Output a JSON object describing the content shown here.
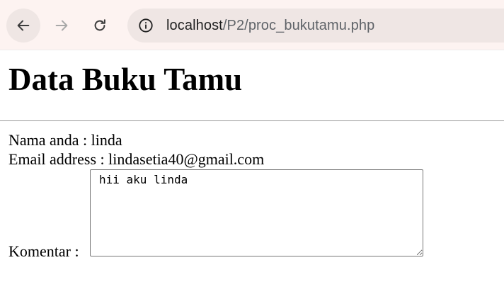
{
  "browser": {
    "url_host": "localhost",
    "url_path": "/P2/proc_bukutamu.php"
  },
  "page": {
    "title": "Data Buku Tamu",
    "name_label": "Nama anda : ",
    "name_value": "linda",
    "email_label": "Email address : ",
    "email_value": "lindasetia40@gmail.com",
    "comment_label": "Komentar : ",
    "comment_value": "hii aku linda"
  },
  "icons": {
    "back": "arrow-left-icon",
    "forward": "arrow-right-icon",
    "reload": "reload-icon",
    "info": "info-circle-icon"
  }
}
